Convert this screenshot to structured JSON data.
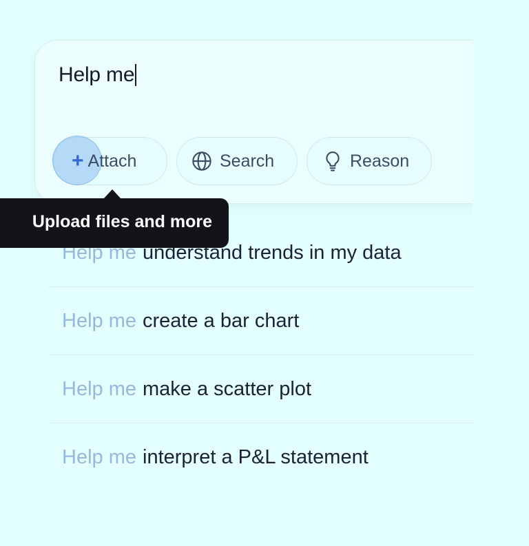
{
  "composer": {
    "input_value": "Help me",
    "chips": {
      "attach_label": "Attach",
      "search_label": "Search",
      "reason_label": "Reason"
    }
  },
  "tooltip": {
    "text": "Upload files and more"
  },
  "suggestions": [
    {
      "prefix": "Help me",
      "rest": "understand trends in my data"
    },
    {
      "prefix": "Help me",
      "rest": "create a bar chart"
    },
    {
      "prefix": "Help me",
      "rest": "make a scatter plot"
    },
    {
      "prefix": "Help me",
      "rest": "interpret a P&L statement"
    }
  ],
  "icons": {
    "attach": "plus-icon",
    "search": "globe-icon",
    "reason": "lightbulb-icon"
  },
  "colors": {
    "background": "#e3fffe",
    "accent": "#3566d8",
    "tooltip_bg": "#12141a",
    "suggestion_prefix": "#97b7dc"
  }
}
